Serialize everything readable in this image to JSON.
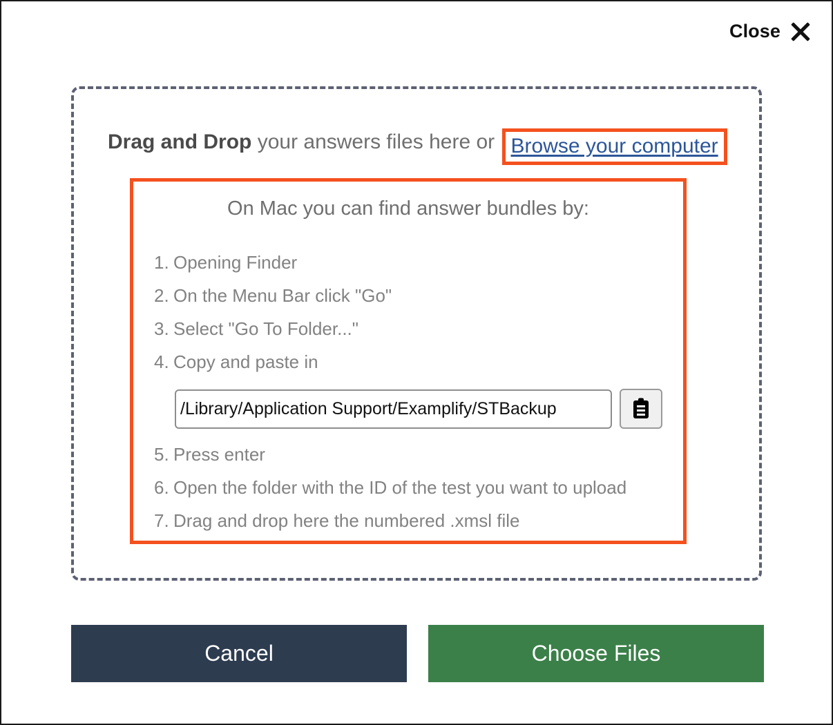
{
  "dialog": {
    "close_label": "Close",
    "close_icon": "close-x-icon"
  },
  "dropzone": {
    "drag_strong": "Drag and Drop",
    "drag_rest": " your answers files here or ",
    "browse_link": "Browse your computer"
  },
  "instructions": {
    "heading": "On Mac you can find answer bundles by:",
    "steps": [
      {
        "num": "1.",
        "text": "Opening Finder"
      },
      {
        "num": "2.",
        "text": "On the Menu Bar click \"Go\""
      },
      {
        "num": "3.",
        "text": "Select \"Go To Folder...\""
      },
      {
        "num": "4.",
        "text": "Copy and paste in"
      },
      {
        "num": "5.",
        "text": "Press enter"
      },
      {
        "num": "6.",
        "text": "Open the folder with the ID of the test you want to upload"
      },
      {
        "num": "7.",
        "text": "Drag and drop here the numbered .xmsl file"
      }
    ],
    "path_value": "/Library/Application Support/Examplify/STBackup",
    "copy_icon": "clipboard-icon"
  },
  "footer": {
    "cancel_label": "Cancel",
    "choose_label": "Choose Files"
  },
  "colors": {
    "highlight": "#f4511e",
    "link": "#2b5699",
    "cancel_bg": "#2e3c50",
    "choose_bg": "#3b8049",
    "dashed_border": "#5d6173"
  }
}
